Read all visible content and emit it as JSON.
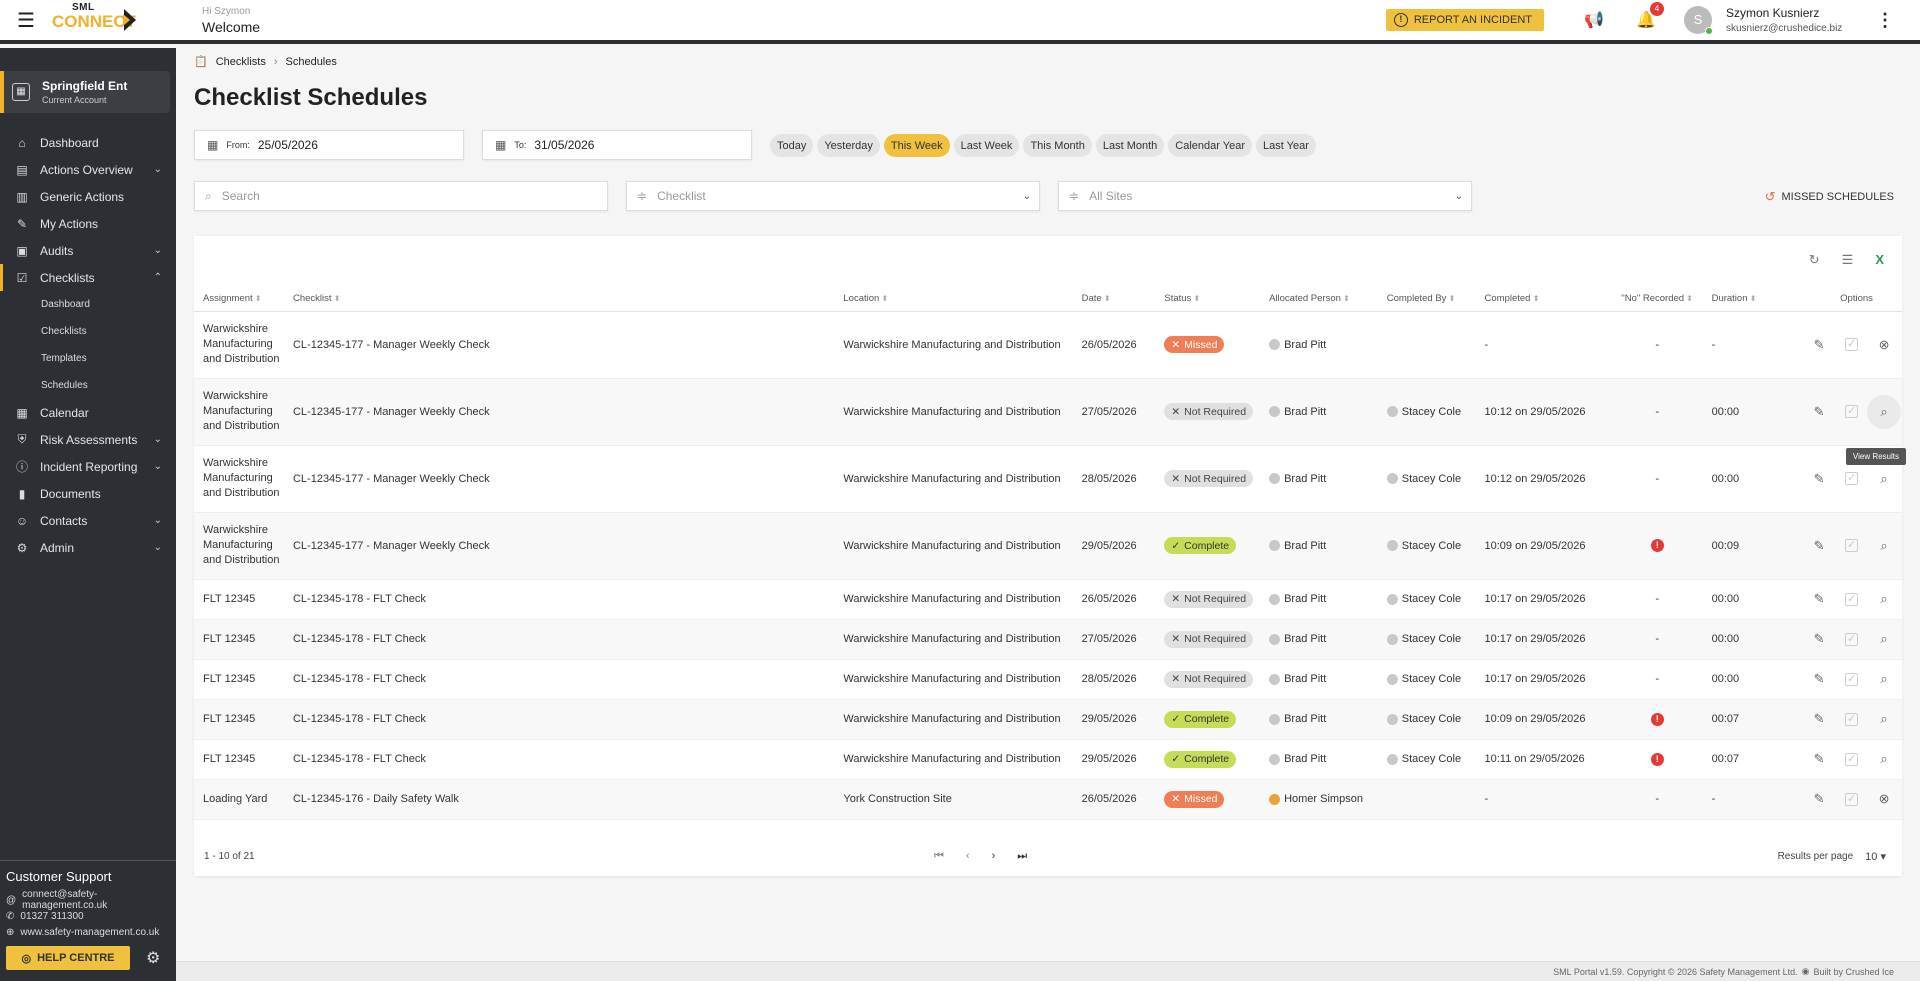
{
  "topbar": {
    "greeting": "Hi Szymon",
    "welcome": "Welcome",
    "logo_top": "SML",
    "logo_main": "CONNECT",
    "report_label": "REPORT AN INCIDENT",
    "notifications": "4",
    "avatar_initial": "S",
    "user_name": "Szymon Kusnierz",
    "user_email": "skusnierz@crushedice.biz"
  },
  "sidebar": {
    "account_name": "Springfield Ent",
    "account_sub": "Current Account",
    "items": [
      {
        "label": "Dashboard",
        "icon": "⌂"
      },
      {
        "label": "Actions Overview",
        "icon": "▤",
        "chev": "⌄"
      },
      {
        "label": "Generic Actions",
        "icon": "▥"
      },
      {
        "label": "My Actions",
        "icon": "✎"
      },
      {
        "label": "Audits",
        "icon": "▣",
        "chev": "⌄"
      },
      {
        "label": "Checklists",
        "icon": "☑",
        "chev": "⌃"
      }
    ],
    "subitems": [
      "Dashboard",
      "Checklists",
      "Templates",
      "Schedules"
    ],
    "items2": [
      {
        "label": "Calendar",
        "icon": "▦"
      },
      {
        "label": "Risk Assessments",
        "icon": "⛨",
        "chev": "⌄"
      },
      {
        "label": "Incident Reporting",
        "icon": "ⓘ",
        "chev": "⌄"
      },
      {
        "label": "Documents",
        "icon": "▮"
      },
      {
        "label": "Contacts",
        "icon": "☺",
        "chev": "⌄"
      },
      {
        "label": "Admin",
        "icon": "⚙",
        "chev": "⌄"
      }
    ],
    "support_title": "Customer Support",
    "support_email": "connect@safety-management.co.uk",
    "support_phone": "01327 311300",
    "support_web": "www.safety-management.co.uk",
    "help_label": "HELP CENTRE"
  },
  "breadcrumb": {
    "first": "Checklists",
    "second": "Schedules"
  },
  "page_title": "Checklist Schedules",
  "filters": {
    "from_label": "From:",
    "from_value": "25/05/2026",
    "to_label": "To:",
    "to_value": "31/05/2026",
    "presets": [
      "Today",
      "Yesterday",
      "This Week",
      "Last Week",
      "This Month",
      "Last Month",
      "Calendar Year",
      "Last Year"
    ],
    "active_preset": "This Week",
    "search_placeholder": "Search",
    "checklist_placeholder": "Checklist",
    "sites_placeholder": "All Sites",
    "missed_label": "MISSED SCHEDULES"
  },
  "table": {
    "headers": [
      "Assignment",
      "Checklist",
      "Location",
      "Date",
      "Status",
      "Allocated Person",
      "Completed By",
      "Completed",
      "\"No\" Recorded",
      "Duration",
      "Options"
    ],
    "rows": [
      {
        "assignment": "Warwickshire Manufacturing and Distribution",
        "checklist": "CL-12345-177 - Manager Weekly Check",
        "location": "Warwickshire Manufacturing and Distribution",
        "date": "26/05/2026",
        "status": "Missed",
        "status_type": "missed",
        "allocated": "Brad Pitt",
        "completed_by": "",
        "completed": "-",
        "no_recorded": "-",
        "duration": "-"
      },
      {
        "assignment": "Warwickshire Manufacturing and Distribution",
        "checklist": "CL-12345-177 - Manager Weekly Check",
        "location": "Warwickshire Manufacturing and Distribution",
        "date": "27/05/2026",
        "status": "Not Required",
        "status_type": "notreq",
        "allocated": "Brad Pitt",
        "completed_by": "Stacey Cole",
        "completed": "10:12 on 29/05/2026",
        "no_recorded": "-",
        "duration": "00:00"
      },
      {
        "assignment": "Warwickshire Manufacturing and Distribution",
        "checklist": "CL-12345-177 - Manager Weekly Check",
        "location": "Warwickshire Manufacturing and Distribution",
        "date": "28/05/2026",
        "status": "Not Required",
        "status_type": "notreq",
        "allocated": "Brad Pitt",
        "completed_by": "Stacey Cole",
        "completed": "10:12 on 29/05/2026",
        "no_recorded": "-",
        "duration": "00:00"
      },
      {
        "assignment": "Warwickshire Manufacturing and Distribution",
        "checklist": "CL-12345-177 - Manager Weekly Check",
        "location": "Warwickshire Manufacturing and Distribution",
        "date": "29/05/2026",
        "status": "Complete",
        "status_type": "complete",
        "allocated": "Brad Pitt",
        "completed_by": "Stacey Cole",
        "completed": "10:09 on 29/05/2026",
        "no_recorded": "!",
        "duration": "00:09"
      },
      {
        "assignment": "FLT 12345",
        "checklist": "CL-12345-178 - FLT Check",
        "location": "Warwickshire Manufacturing and Distribution",
        "date": "26/05/2026",
        "status": "Not Required",
        "status_type": "notreq",
        "allocated": "Brad Pitt",
        "completed_by": "Stacey Cole",
        "completed": "10:17 on 29/05/2026",
        "no_recorded": "-",
        "duration": "00:00"
      },
      {
        "assignment": "FLT 12345",
        "checklist": "CL-12345-178 - FLT Check",
        "location": "Warwickshire Manufacturing and Distribution",
        "date": "27/05/2026",
        "status": "Not Required",
        "status_type": "notreq",
        "allocated": "Brad Pitt",
        "completed_by": "Stacey Cole",
        "completed": "10:17 on 29/05/2026",
        "no_recorded": "-",
        "duration": "00:00"
      },
      {
        "assignment": "FLT 12345",
        "checklist": "CL-12345-178 - FLT Check",
        "location": "Warwickshire Manufacturing and Distribution",
        "date": "28/05/2026",
        "status": "Not Required",
        "status_type": "notreq",
        "allocated": "Brad Pitt",
        "completed_by": "Stacey Cole",
        "completed": "10:17 on 29/05/2026",
        "no_recorded": "-",
        "duration": "00:00"
      },
      {
        "assignment": "FLT 12345",
        "checklist": "CL-12345-178 - FLT Check",
        "location": "Warwickshire Manufacturing and Distribution",
        "date": "29/05/2026",
        "status": "Complete",
        "status_type": "complete",
        "allocated": "Brad Pitt",
        "completed_by": "Stacey Cole",
        "completed": "10:09 on 29/05/2026",
        "no_recorded": "!",
        "duration": "00:07"
      },
      {
        "assignment": "FLT 12345",
        "checklist": "CL-12345-178 - FLT Check",
        "location": "Warwickshire Manufacturing and Distribution",
        "date": "29/05/2026",
        "status": "Complete",
        "status_type": "complete",
        "allocated": "Brad Pitt",
        "completed_by": "Stacey Cole",
        "completed": "10:11 on 29/05/2026",
        "no_recorded": "!",
        "duration": "00:07"
      },
      {
        "assignment": "Loading Yard",
        "checklist": "CL-12345-176 - Daily Safety Walk",
        "location": "York Construction Site",
        "date": "26/05/2026",
        "status": "Missed",
        "status_type": "missed",
        "allocated": "Homer Simpson",
        "completed_by": "",
        "completed": "-",
        "no_recorded": "-",
        "duration": "-"
      }
    ],
    "tooltip": "View Results",
    "range": "1 - 10 of 21",
    "rpp_label": "Results per page",
    "rpp_value": "10"
  },
  "footer": {
    "text": "SML Portal v1.59. Copyright © 2026 Safety Management Ltd.",
    "built": "Built by Crushed Ice"
  },
  "colors": {
    "accent": "#f0c13e",
    "missed": "#ef7d56",
    "complete": "#c4dc58",
    "sidebar": "#2c2f33"
  }
}
